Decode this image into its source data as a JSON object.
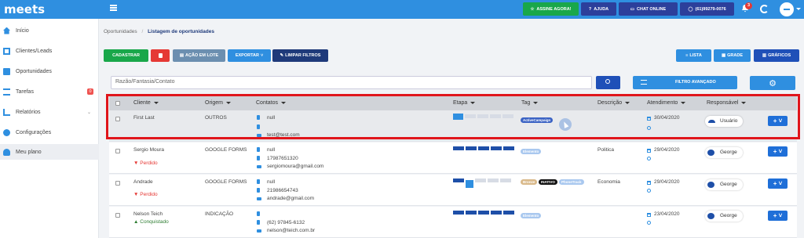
{
  "app": {
    "brand": "meets"
  },
  "topbar": {
    "buttons": [
      {
        "label": "ASSINE AGORA!",
        "icon": "star-icon"
      },
      {
        "label": "AJUDA",
        "icon": "help-icon"
      },
      {
        "label": "CHAT ONLINE",
        "icon": "chat-icon"
      },
      {
        "label": "(61)99279-0076",
        "icon": "whatsapp-icon"
      }
    ],
    "notification_count": "3"
  },
  "sidebar": {
    "items": [
      {
        "label": "Início",
        "icon": "home-icon"
      },
      {
        "label": "Clientes/Leads",
        "icon": "building-icon"
      },
      {
        "label": "Oportunidades",
        "icon": "briefcase-icon"
      },
      {
        "label": "Tarefas",
        "icon": "tasks-icon",
        "badge": "0"
      },
      {
        "label": "Relatórios",
        "icon": "reports-icon"
      },
      {
        "label": "Configurações",
        "icon": "gear-icon"
      },
      {
        "label": "Meu plano",
        "icon": "user-icon"
      }
    ]
  },
  "breadcrumb": {
    "root": "Oportunidades",
    "sep": "/",
    "current": "Listagem de oportunidades"
  },
  "actions": {
    "cadastrar": "CADASTRAR",
    "lote": "AÇÃO EM LOTE",
    "exportar": "EXPORTAR",
    "limpar": "LIMPAR FILTROS"
  },
  "views": {
    "lista": "LISTA",
    "grade": "GRADE",
    "graficos": "GRÁFICOS"
  },
  "search": {
    "placeholder": "Razão/Fantasia/Contato"
  },
  "advanced_filter": "FILTRO AVANÇADO",
  "table": {
    "headers": {
      "cliente": "Cliente",
      "origem": "Origem",
      "contatos": "Contatos",
      "etapa": "Etapa",
      "tag": "Tag",
      "descricao": "Descrição",
      "atendimento": "Atendimento",
      "responsavel": "Responsável"
    },
    "rows": [
      {
        "cliente": "First Last",
        "status": "",
        "origem": "OUTROS",
        "phone": "null",
        "mobile": "",
        "email": "test@test.com",
        "stages": 1,
        "tags": [
          "ActiveCampaign"
        ],
        "descricao": "",
        "data": "30/04/2020",
        "responsavel": "Usuário"
      },
      {
        "cliente": "Sergio Moura",
        "status": "Perdido",
        "origem": "GOOGLE FORMS",
        "phone": "null",
        "mobile": "17987651320",
        "email": "sergiomoura@gmail.com",
        "stages": 5,
        "tags": [
          "Elemento"
        ],
        "descricao": "Politica",
        "data": "29/04/2020",
        "responsavel": "George"
      },
      {
        "cliente": "Andrade",
        "status": "Perdido",
        "origem": "GOOGLE FORMS",
        "phone": "null",
        "mobile": "21986654743",
        "email": "andrade@gmail.com",
        "stages": 1,
        "tags": [
          "Bronze",
          "INATIVO",
          "PhoneTrack"
        ],
        "descricao": "Economia",
        "data": "29/04/2020",
        "responsavel": "George"
      },
      {
        "cliente": "Nelson Teich",
        "status": "Conquistado",
        "origem": "INDICAÇÃO",
        "phone": "(62) 97845-6132",
        "mobile": "",
        "email": "nelson@teich.com.br",
        "stages": 5,
        "tags": [
          "Elemento"
        ],
        "descricao": "",
        "data": "23/04/2020",
        "responsavel": "George"
      }
    ]
  },
  "colors": {
    "primary": "#2f8fe0",
    "dark": "#1e4fa8",
    "green": "#19a74a",
    "highlight": "#e0151b"
  }
}
